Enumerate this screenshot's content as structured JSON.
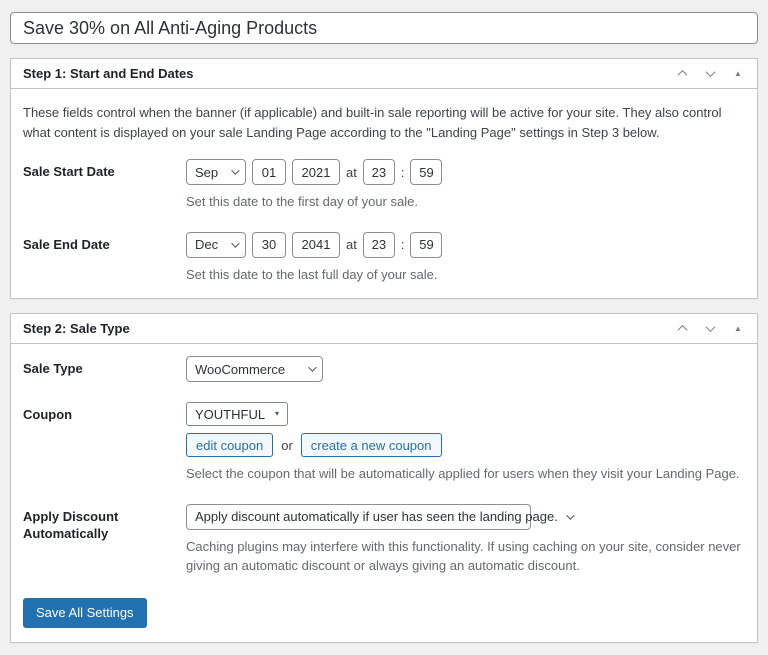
{
  "colors": {
    "accent": "#2271b1",
    "page_background": "#f0f0f1",
    "panel_border": "#c3c4c7",
    "input_border": "#8c8f94",
    "helper_text": "#646970"
  },
  "page": {
    "title_value": "Save 30% on All Anti-Aging Products"
  },
  "step1": {
    "title": "Step 1: Start and End Dates",
    "description": "These fields control when the banner (if applicable) and built-in sale reporting will be active for your site. They also control what content is displayed on your sale Landing Page according to the \"Landing Page\" settings in Step 3 below.",
    "start": {
      "label": "Sale Start Date",
      "month": "Sep",
      "day": "01",
      "year": "2021",
      "at_label": "at",
      "hour": "23",
      "colon": ":",
      "minute": "59",
      "helper": "Set this date to the first day of your sale."
    },
    "end": {
      "label": "Sale End Date",
      "month": "Dec",
      "day": "30",
      "year": "2041",
      "at_label": "at",
      "hour": "23",
      "colon": ":",
      "minute": "59",
      "helper": "Set this date to the last full day of your sale."
    }
  },
  "step2": {
    "title": "Step 2: Sale Type",
    "sale_type": {
      "label": "Sale Type",
      "value": "WooCommerce"
    },
    "coupon": {
      "label": "Coupon",
      "value": "YOUTHFUL",
      "edit_button": "edit coupon",
      "or_label": "or",
      "create_button": "create a new coupon",
      "helper": "Select the coupon that will be automatically applied for users when they visit your Landing Page."
    },
    "apply_discount": {
      "label": "Apply Discount Automatically",
      "value": "Apply discount automatically if user has seen the landing page.",
      "helper": "Caching plugins may interfere with this functionality. If using caching on your site, consider never giving an automatic discount or always giving an automatic discount."
    },
    "save_button": "Save All Settings"
  }
}
